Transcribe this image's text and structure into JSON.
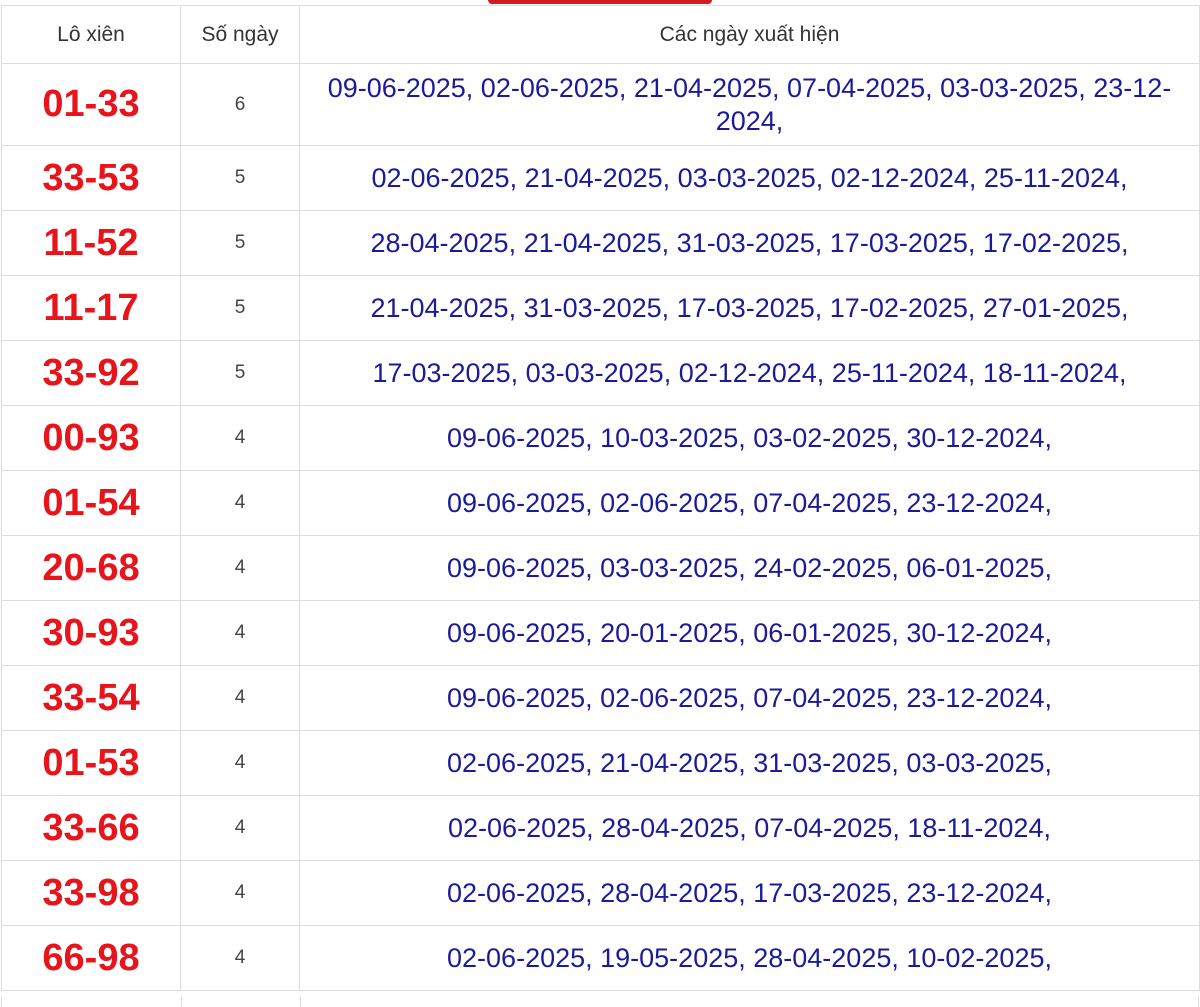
{
  "table": {
    "headers": {
      "pair": "Lô xiên",
      "count": "Số ngày",
      "dates": "Các ngày xuất hiện"
    },
    "rows": [
      {
        "pair": "01-33",
        "count": "6",
        "dates": "09-06-2025, 02-06-2025, 21-04-2025, 07-04-2025, 03-03-2025, 23-12-2024,"
      },
      {
        "pair": "33-53",
        "count": "5",
        "dates": "02-06-2025, 21-04-2025, 03-03-2025, 02-12-2024, 25-11-2024,"
      },
      {
        "pair": "11-52",
        "count": "5",
        "dates": "28-04-2025, 21-04-2025, 31-03-2025, 17-03-2025, 17-02-2025,"
      },
      {
        "pair": "11-17",
        "count": "5",
        "dates": "21-04-2025, 31-03-2025, 17-03-2025, 17-02-2025, 27-01-2025,"
      },
      {
        "pair": "33-92",
        "count": "5",
        "dates": "17-03-2025, 03-03-2025, 02-12-2024, 25-11-2024, 18-11-2024,"
      },
      {
        "pair": "00-93",
        "count": "4",
        "dates": "09-06-2025, 10-03-2025, 03-02-2025, 30-12-2024,"
      },
      {
        "pair": "01-54",
        "count": "4",
        "dates": "09-06-2025, 02-06-2025, 07-04-2025, 23-12-2024,"
      },
      {
        "pair": "20-68",
        "count": "4",
        "dates": "09-06-2025, 03-03-2025, 24-02-2025, 06-01-2025,"
      },
      {
        "pair": "30-93",
        "count": "4",
        "dates": "09-06-2025, 20-01-2025, 06-01-2025, 30-12-2024,"
      },
      {
        "pair": "33-54",
        "count": "4",
        "dates": "09-06-2025, 02-06-2025, 07-04-2025, 23-12-2024,"
      },
      {
        "pair": "01-53",
        "count": "4",
        "dates": "02-06-2025, 21-04-2025, 31-03-2025, 03-03-2025,"
      },
      {
        "pair": "33-66",
        "count": "4",
        "dates": "02-06-2025, 28-04-2025, 07-04-2025, 18-11-2024,"
      },
      {
        "pair": "33-98",
        "count": "4",
        "dates": "02-06-2025, 28-04-2025, 17-03-2025, 23-12-2024,"
      },
      {
        "pair": "66-98",
        "count": "4",
        "dates": "02-06-2025, 19-05-2025, 28-04-2025, 10-02-2025,"
      }
    ]
  },
  "colors": {
    "pair": "#e8141b",
    "dates": "#1b1b9a",
    "count": "#444444",
    "header": "#333333",
    "tab_accent": "#d71920"
  }
}
